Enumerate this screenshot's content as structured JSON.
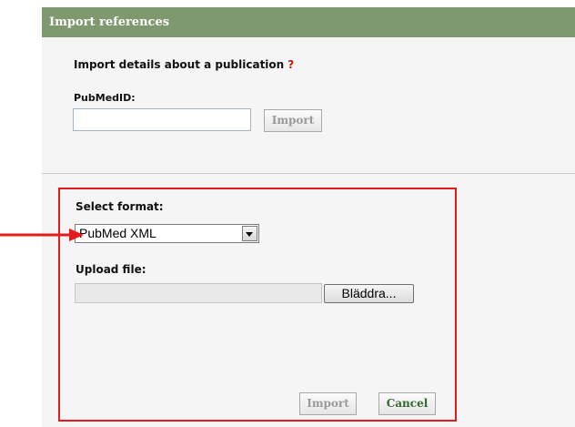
{
  "panel": {
    "title": "Import references"
  },
  "pubmed_section": {
    "heading": "Import details about a publication",
    "help_mark": "?",
    "pubmed_label": "PubMedID:",
    "pubmed_value": "",
    "import_label": "Import"
  },
  "format_section": {
    "select_label": "Select format:",
    "selected_format": "PubMed XML",
    "upload_label": "Upload file:",
    "file_path": "",
    "browse_label": "Bläddra...",
    "import_label": "Import",
    "cancel_label": "Cancel"
  },
  "colors": {
    "header_bg": "#7f986d",
    "highlight": "#e21b1b",
    "help_mark": "#cc1111",
    "cancel_text": "#2f6a2f",
    "disabled_text": "#9a9a9a"
  },
  "icons": {
    "format_dropdown": "chevron-down-icon",
    "annotation": "red-arrow-icon"
  }
}
